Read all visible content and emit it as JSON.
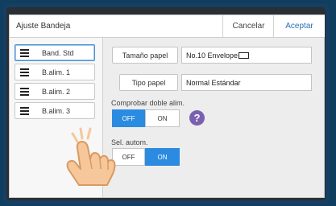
{
  "dialog": {
    "title": "Ajuste Bandeja",
    "cancel_label": "Cancelar",
    "accept_label": "Aceptar"
  },
  "sidebar": {
    "items": [
      {
        "label": "Band. Std",
        "icon": "tray-icon",
        "active": true
      },
      {
        "label": "B.alim. 1",
        "icon": "tray-icon",
        "active": false
      },
      {
        "label": "B.alim. 2",
        "icon": "tray-icon",
        "active": false
      },
      {
        "label": "B.alim. 3",
        "icon": "tray-icon",
        "active": false
      }
    ]
  },
  "main": {
    "paper_size": {
      "label": "Tamaño papel",
      "value": "No.10 Envelope"
    },
    "paper_type": {
      "label": "Tipo papel",
      "value": "Normal Estándar"
    },
    "double_feed": {
      "label": "Comprobar doble alim.",
      "off": "OFF",
      "on": "ON",
      "selected": "OFF",
      "help": "?"
    },
    "auto_select": {
      "label": "Sel. autom.",
      "off": "OFF",
      "on": "ON",
      "selected": "ON"
    }
  },
  "colors": {
    "accent": "#2b8be0",
    "help": "#7b5fb0",
    "hand": "#f6c79a",
    "frame": "#163f63"
  }
}
